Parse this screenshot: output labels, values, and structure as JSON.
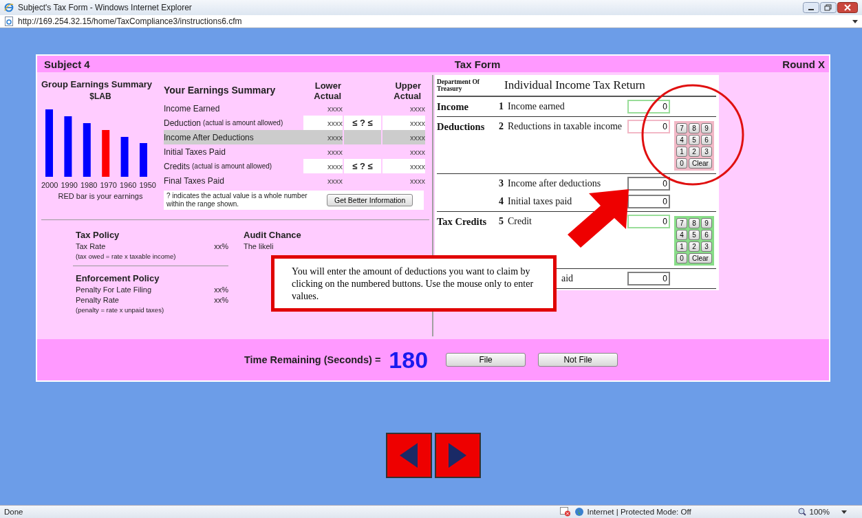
{
  "window": {
    "title": "Subject's Tax Form - Windows Internet Explorer"
  },
  "address_bar": {
    "url": "http://169.254.32.15/home/TaxCompliance3/instructions6.cfm"
  },
  "header": {
    "left": "Subject 4",
    "center": "Tax Form",
    "right": "Round X"
  },
  "group_earnings": {
    "title": "Group Earnings Summary",
    "unit": "$LAB",
    "caption": "RED bar is your earnings",
    "bars": [
      {
        "label": "2000",
        "color": "#0000ff"
      },
      {
        "label": "1990",
        "color": "#0000ff"
      },
      {
        "label": "1980",
        "color": "#0000ff"
      },
      {
        "label": "1970",
        "color": "#ff0000"
      },
      {
        "label": "1960",
        "color": "#0000ff"
      },
      {
        "label": "1950",
        "color": "#0000ff"
      }
    ]
  },
  "your_earnings": {
    "title": "Your Earnings Summary",
    "columns": [
      "Lower Actual",
      "Upper Actual"
    ],
    "rows": [
      {
        "label": "Income Earned",
        "kind": "plain",
        "lower": "xxxx",
        "upper": "xxxx",
        "selected": false
      },
      {
        "label": "Deduction",
        "note": "(actual is amount allowed)",
        "kind": "range",
        "range": "≤ ? ≤",
        "lower": "xxxx",
        "upper": "xxxx",
        "selected": false
      },
      {
        "label": "Income After Deductions",
        "kind": "plain",
        "lower": "xxxx",
        "upper": "xxxx",
        "selected": true
      },
      {
        "label": "Initial Taxes Paid",
        "kind": "plain",
        "lower": "xxxx",
        "upper": "xxxx",
        "selected": false
      },
      {
        "label": "Credits",
        "note": "(actual is amount allowed)",
        "kind": "range",
        "range": "≤ ? ≤",
        "lower": "xxxx",
        "upper": "xxxx",
        "selected": false
      },
      {
        "label": "Final Taxes Paid",
        "kind": "plain",
        "lower": "xxxx",
        "upper": "xxxx",
        "selected": false
      }
    ],
    "note": "? indicates the actual value is a whole number within the range shown.",
    "button": "Get Better Information"
  },
  "tax_policy": {
    "title": "Tax Policy",
    "items": [
      {
        "label": "Tax Rate",
        "value": "xx%",
        "note": "(tax owed = rate x taxable income)"
      }
    ]
  },
  "enforcement_policy": {
    "title": "Enforcement Policy",
    "items": [
      {
        "label": "Penalty For Late Filing",
        "value": "xx%"
      },
      {
        "label": "Penalty Rate",
        "value": "xx%",
        "note": "(penalty = rate x unpaid taxes)"
      }
    ]
  },
  "audit_chance": {
    "title": "Audit Chance",
    "text": "The likeli"
  },
  "tax_form": {
    "department": "Department Of Treasury",
    "title": "Individual Income Tax Return",
    "sections": [
      {
        "label": "Income",
        "lines": [
          {
            "number": "1",
            "label": "Income earned",
            "value": "0",
            "color": "#99dd99"
          }
        ]
      },
      {
        "label": "Deductions",
        "lines": [
          {
            "number": "2",
            "label": "Reductions in taxable income",
            "value": "0",
            "color": "#f2b8c6"
          }
        ],
        "keypad": {
          "color": "#f2b8c6",
          "keys": [
            "7",
            "8",
            "9",
            "4",
            "5",
            "6",
            "1",
            "2",
            "3",
            "0",
            "Clear"
          ]
        }
      },
      {
        "lines": [
          {
            "number": "3",
            "label": "Income after deductions",
            "value": "0",
            "color": "#808080"
          },
          {
            "number": "4",
            "label": "Initial taxes paid",
            "value": "0",
            "color": "#808080"
          }
        ]
      },
      {
        "label": "Tax Credits",
        "lines": [
          {
            "number": "5",
            "label": "Credit",
            "value": "0",
            "color": "#99dd99"
          }
        ],
        "keypad": {
          "color": "#88dd88",
          "keys": [
            "7",
            "8",
            "9",
            "4",
            "5",
            "6",
            "1",
            "2",
            "3",
            "0",
            "Clear"
          ]
        }
      },
      {
        "lines": [
          {
            "label": "aid",
            "kind": "covered",
            "value": "0",
            "color": "#808080"
          }
        ]
      }
    ]
  },
  "instruction": {
    "text": "You will enter the amount of deductions you want to claim by clicking on the numbered buttons. Use the mouse only to enter values."
  },
  "timer": {
    "label": "Time Remaining (Seconds) =",
    "value": "180"
  },
  "actions": [
    "File",
    "Not File"
  ],
  "status_bar": {
    "text": "Done",
    "zone": "Internet | Protected Mode: Off",
    "zoom": "100%"
  }
}
